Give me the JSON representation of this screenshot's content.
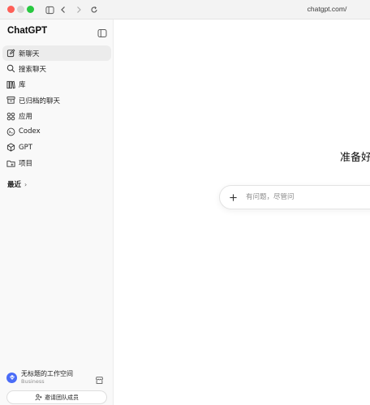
{
  "browser": {
    "url": "chatgpt.com/"
  },
  "sidebar": {
    "brand": "ChatGPT",
    "items": [
      {
        "label": "新聊天",
        "icon": "new-chat-icon",
        "active": true
      },
      {
        "label": "搜索聊天",
        "icon": "search-icon",
        "active": false
      },
      {
        "label": "库",
        "icon": "library-icon",
        "active": false
      },
      {
        "label": "已归档的聊天",
        "icon": "archive-icon",
        "active": false
      },
      {
        "label": "应用",
        "icon": "apps-icon",
        "active": false
      },
      {
        "label": "Codex",
        "icon": "codex-icon",
        "active": false
      },
      {
        "label": "GPT",
        "icon": "gpt-cube-icon",
        "active": false
      },
      {
        "label": "项目",
        "icon": "folder-icon",
        "active": false
      }
    ],
    "recent_label": "最近",
    "workspace": {
      "name": "无标题的工作空间",
      "plan": "Business"
    },
    "invite_label": "邀请团队成员"
  },
  "main": {
    "headline": "准备好",
    "composer": {
      "placeholder": "有问题，尽管问"
    }
  },
  "colors": {
    "sidebar_bg": "#f9f9f9",
    "active_item_bg": "#ececec",
    "workspace_logo": "#4a6cf7"
  }
}
